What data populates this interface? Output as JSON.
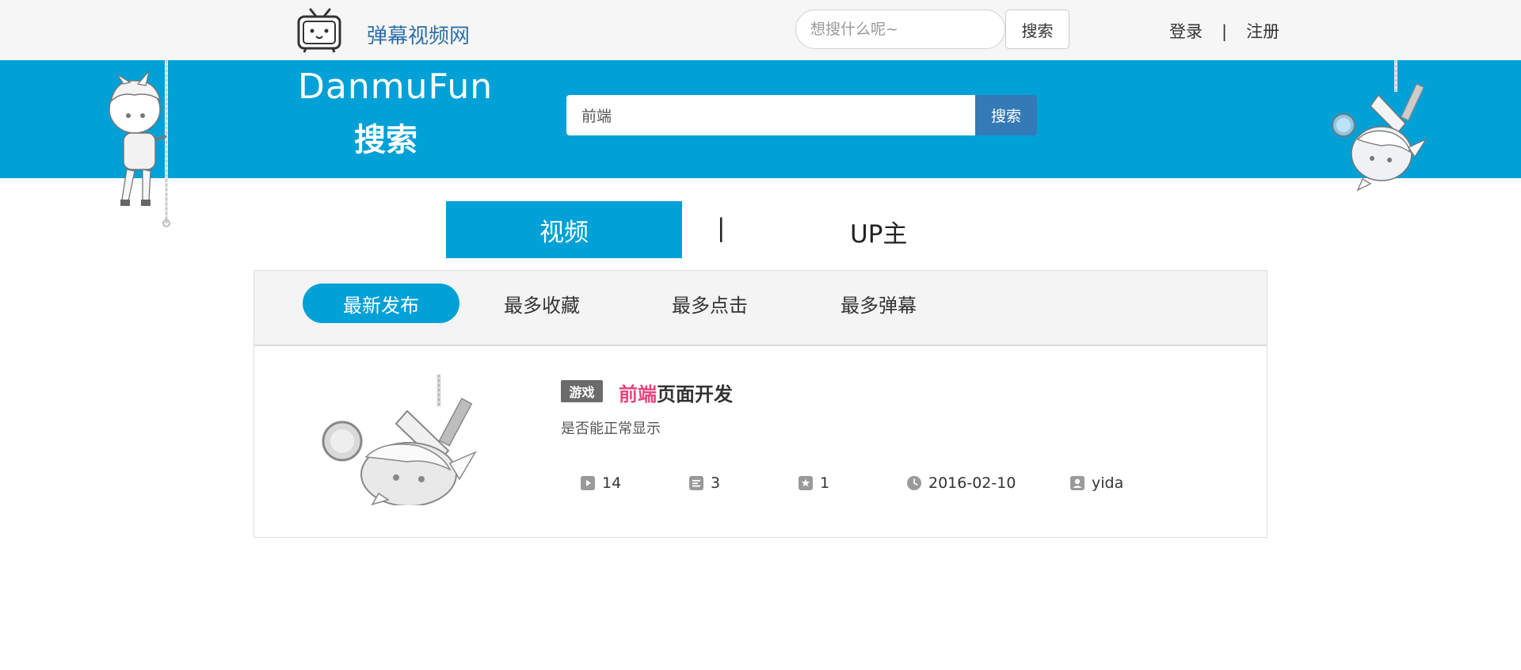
{
  "header": {
    "site_name": "弹幕视频网",
    "search_placeholder": "想搜什么呢~",
    "search_button": "搜索",
    "login": "登录",
    "separator": "|",
    "register": "注册"
  },
  "banner": {
    "brand_en": "DanmuFun",
    "brand_cn": "搜索",
    "search_value": "前端",
    "search_button": "搜索"
  },
  "category_tabs": {
    "video": "视频",
    "separator": "|",
    "up": "UP主",
    "active": "视频"
  },
  "sort_tabs": [
    {
      "label": "最新发布",
      "active": true
    },
    {
      "label": "最多收藏",
      "active": false
    },
    {
      "label": "最多点击",
      "active": false
    },
    {
      "label": "最多弹幕",
      "active": false
    }
  ],
  "results": [
    {
      "category": "游戏",
      "title_highlight": "前端",
      "title_rest": "页面开发",
      "description": "是否能正常显示",
      "plays": "14",
      "danmaku": "3",
      "favorites": "1",
      "date": "2016-02-10",
      "uploader": "yida"
    }
  ],
  "icons": {
    "play": "play-icon",
    "danmaku": "danmaku-icon",
    "favorite": "star-icon",
    "date": "clock-icon",
    "uploader": "user-icon"
  },
  "colors": {
    "brand_blue": "#00a1d6",
    "button_blue": "#337ab7",
    "highlight_pink": "#e8457a",
    "badge_gray": "#6b6b6b"
  }
}
